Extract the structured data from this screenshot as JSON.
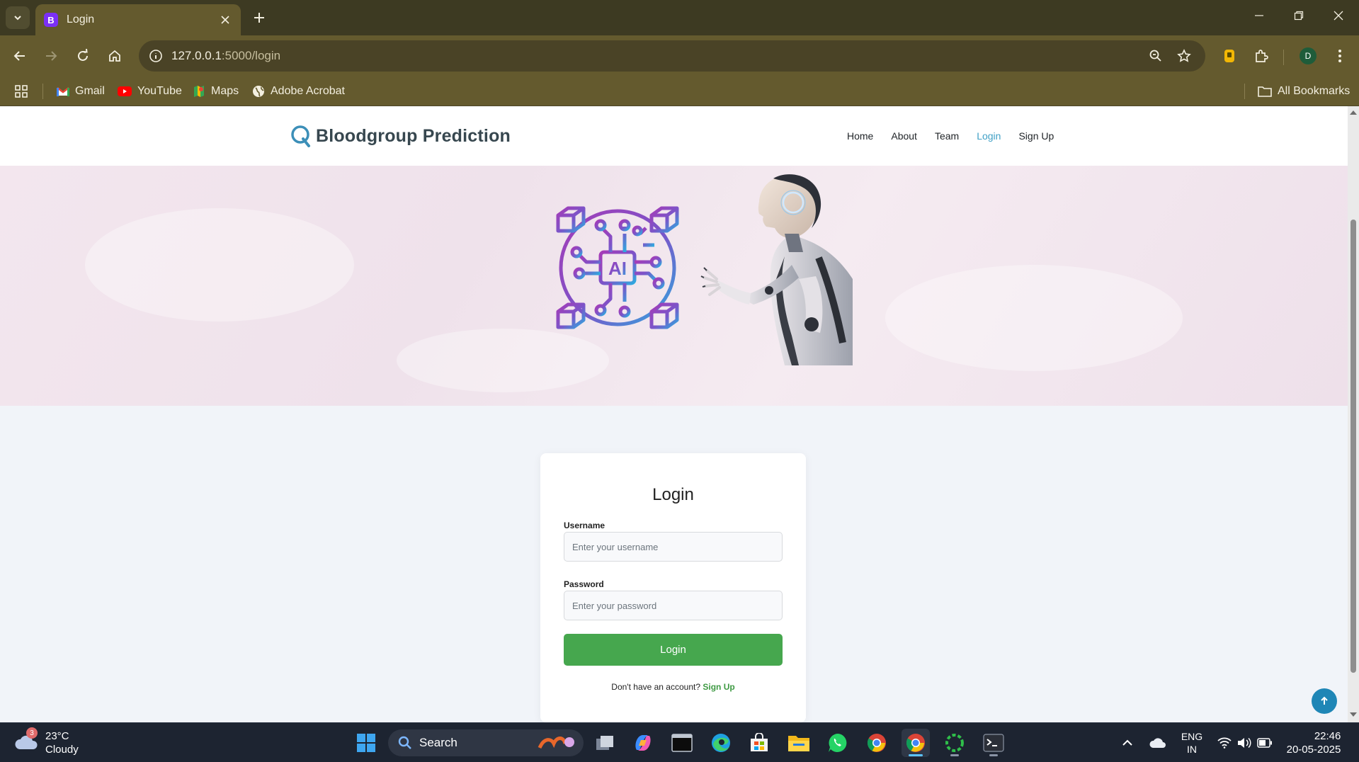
{
  "browser": {
    "tab_title": "Login",
    "tab_favicon_letter": "B",
    "url_host": "127.0.0.1",
    "url_rest": ":5000/login",
    "profile_initial": "D",
    "bookmarks": [
      {
        "label": "Gmail",
        "icon": "gmail-icon"
      },
      {
        "label": "YouTube",
        "icon": "youtube-icon"
      },
      {
        "label": "Maps",
        "icon": "maps-icon"
      },
      {
        "label": "Adobe Acrobat",
        "icon": "globe-icon"
      }
    ],
    "all_bookmarks": "All Bookmarks"
  },
  "site": {
    "brand": "Bloodgroup Prediction",
    "nav": [
      {
        "label": "Home",
        "active": false
      },
      {
        "label": "About",
        "active": false
      },
      {
        "label": "Team",
        "active": false
      },
      {
        "label": "Login",
        "active": true
      },
      {
        "label": "Sign Up",
        "active": false
      }
    ],
    "hero_chip_text": "AI"
  },
  "login": {
    "title": "Login",
    "username_label": "Username",
    "username_placeholder": "Enter your username",
    "password_label": "Password",
    "password_placeholder": "Enter your password",
    "submit_label": "Login",
    "signup_prompt": "Don't have an account?",
    "signup_link": "Sign Up"
  },
  "taskbar": {
    "weather_temp": "23°C",
    "weather_desc": "Cloudy",
    "weather_badge": "3",
    "search_label": "Search",
    "lang_line1": "ENG",
    "lang_line2": "IN",
    "time": "22:46",
    "date": "20-05-2025"
  },
  "colors": {
    "accent_active_nav": "#3fa0c6",
    "login_button": "#46a74e",
    "signup_link": "#3e9a43",
    "browser_frame": "#645a2e"
  }
}
